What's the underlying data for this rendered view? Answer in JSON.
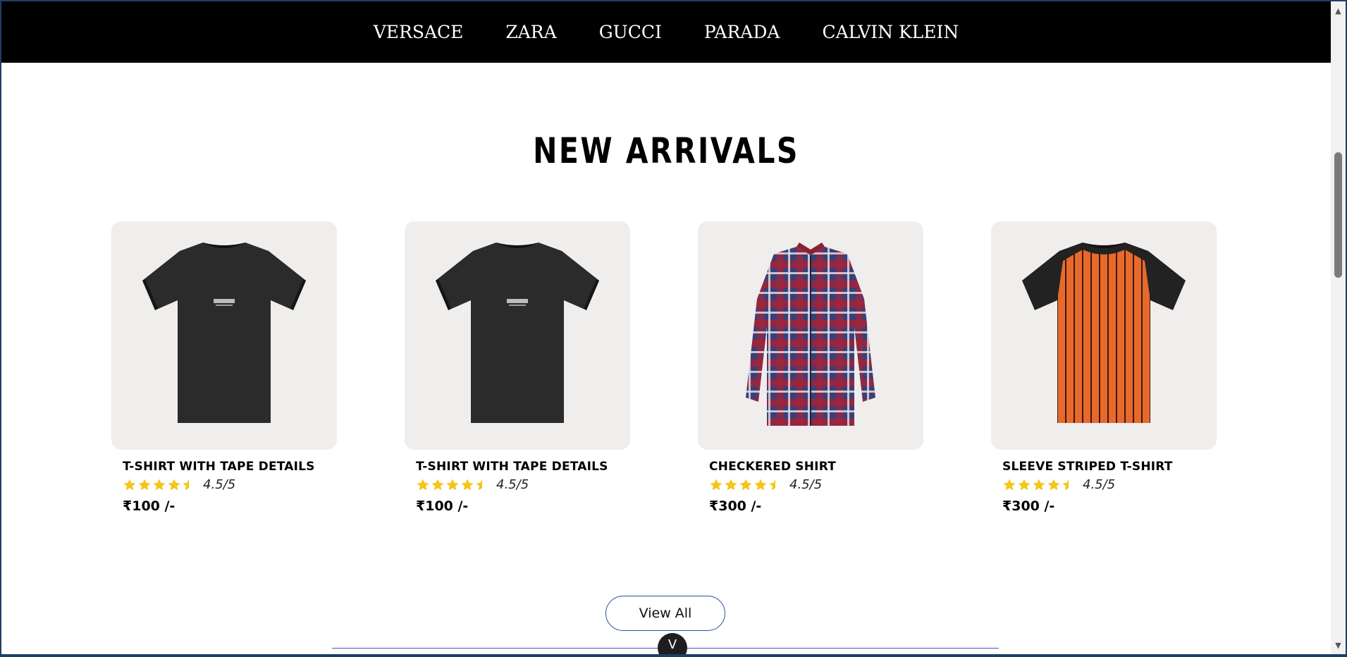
{
  "brands": [
    "VERSACE",
    "ZARA",
    "GUCCI",
    "PARADA",
    "CALVIN KLEIN"
  ],
  "section_title": "NEW ARRIVALS",
  "products": [
    {
      "name": "T-SHIRT WITH TAPE DETAILS",
      "rating": 4.5,
      "rating_text": "4.5/5",
      "price": "₹100 /-",
      "image": "black-tshirt",
      "print": "NEW RULES"
    },
    {
      "name": "T-SHIRT WITH TAPE DETAILS",
      "rating": 4.5,
      "rating_text": "4.5/5",
      "price": "₹100 /-",
      "image": "black-tshirt",
      "print": "NEW RULES"
    },
    {
      "name": "CHECKERED SHIRT",
      "rating": 4.5,
      "rating_text": "4.5/5",
      "price": "₹300 /-",
      "image": "checkered-shirt"
    },
    {
      "name": "SLEEVE STRIPED T-SHIRT",
      "rating": 4.5,
      "rating_text": "4.5/5",
      "price": "₹300 /-",
      "image": "orange-striped-tshirt"
    }
  ],
  "view_all_label": "View All",
  "scroll_down_glyph": "V",
  "icons": {
    "star": "star-icon",
    "half_star": "half-star-icon",
    "scroll_up": "scroll-up-arrow-icon",
    "scroll_down": "scroll-down-arrow-icon"
  },
  "colors": {
    "nav_bg": "#000000",
    "star": "#f5c518",
    "card_bg": "#efeeec",
    "button_border": "#2b4fa0"
  }
}
